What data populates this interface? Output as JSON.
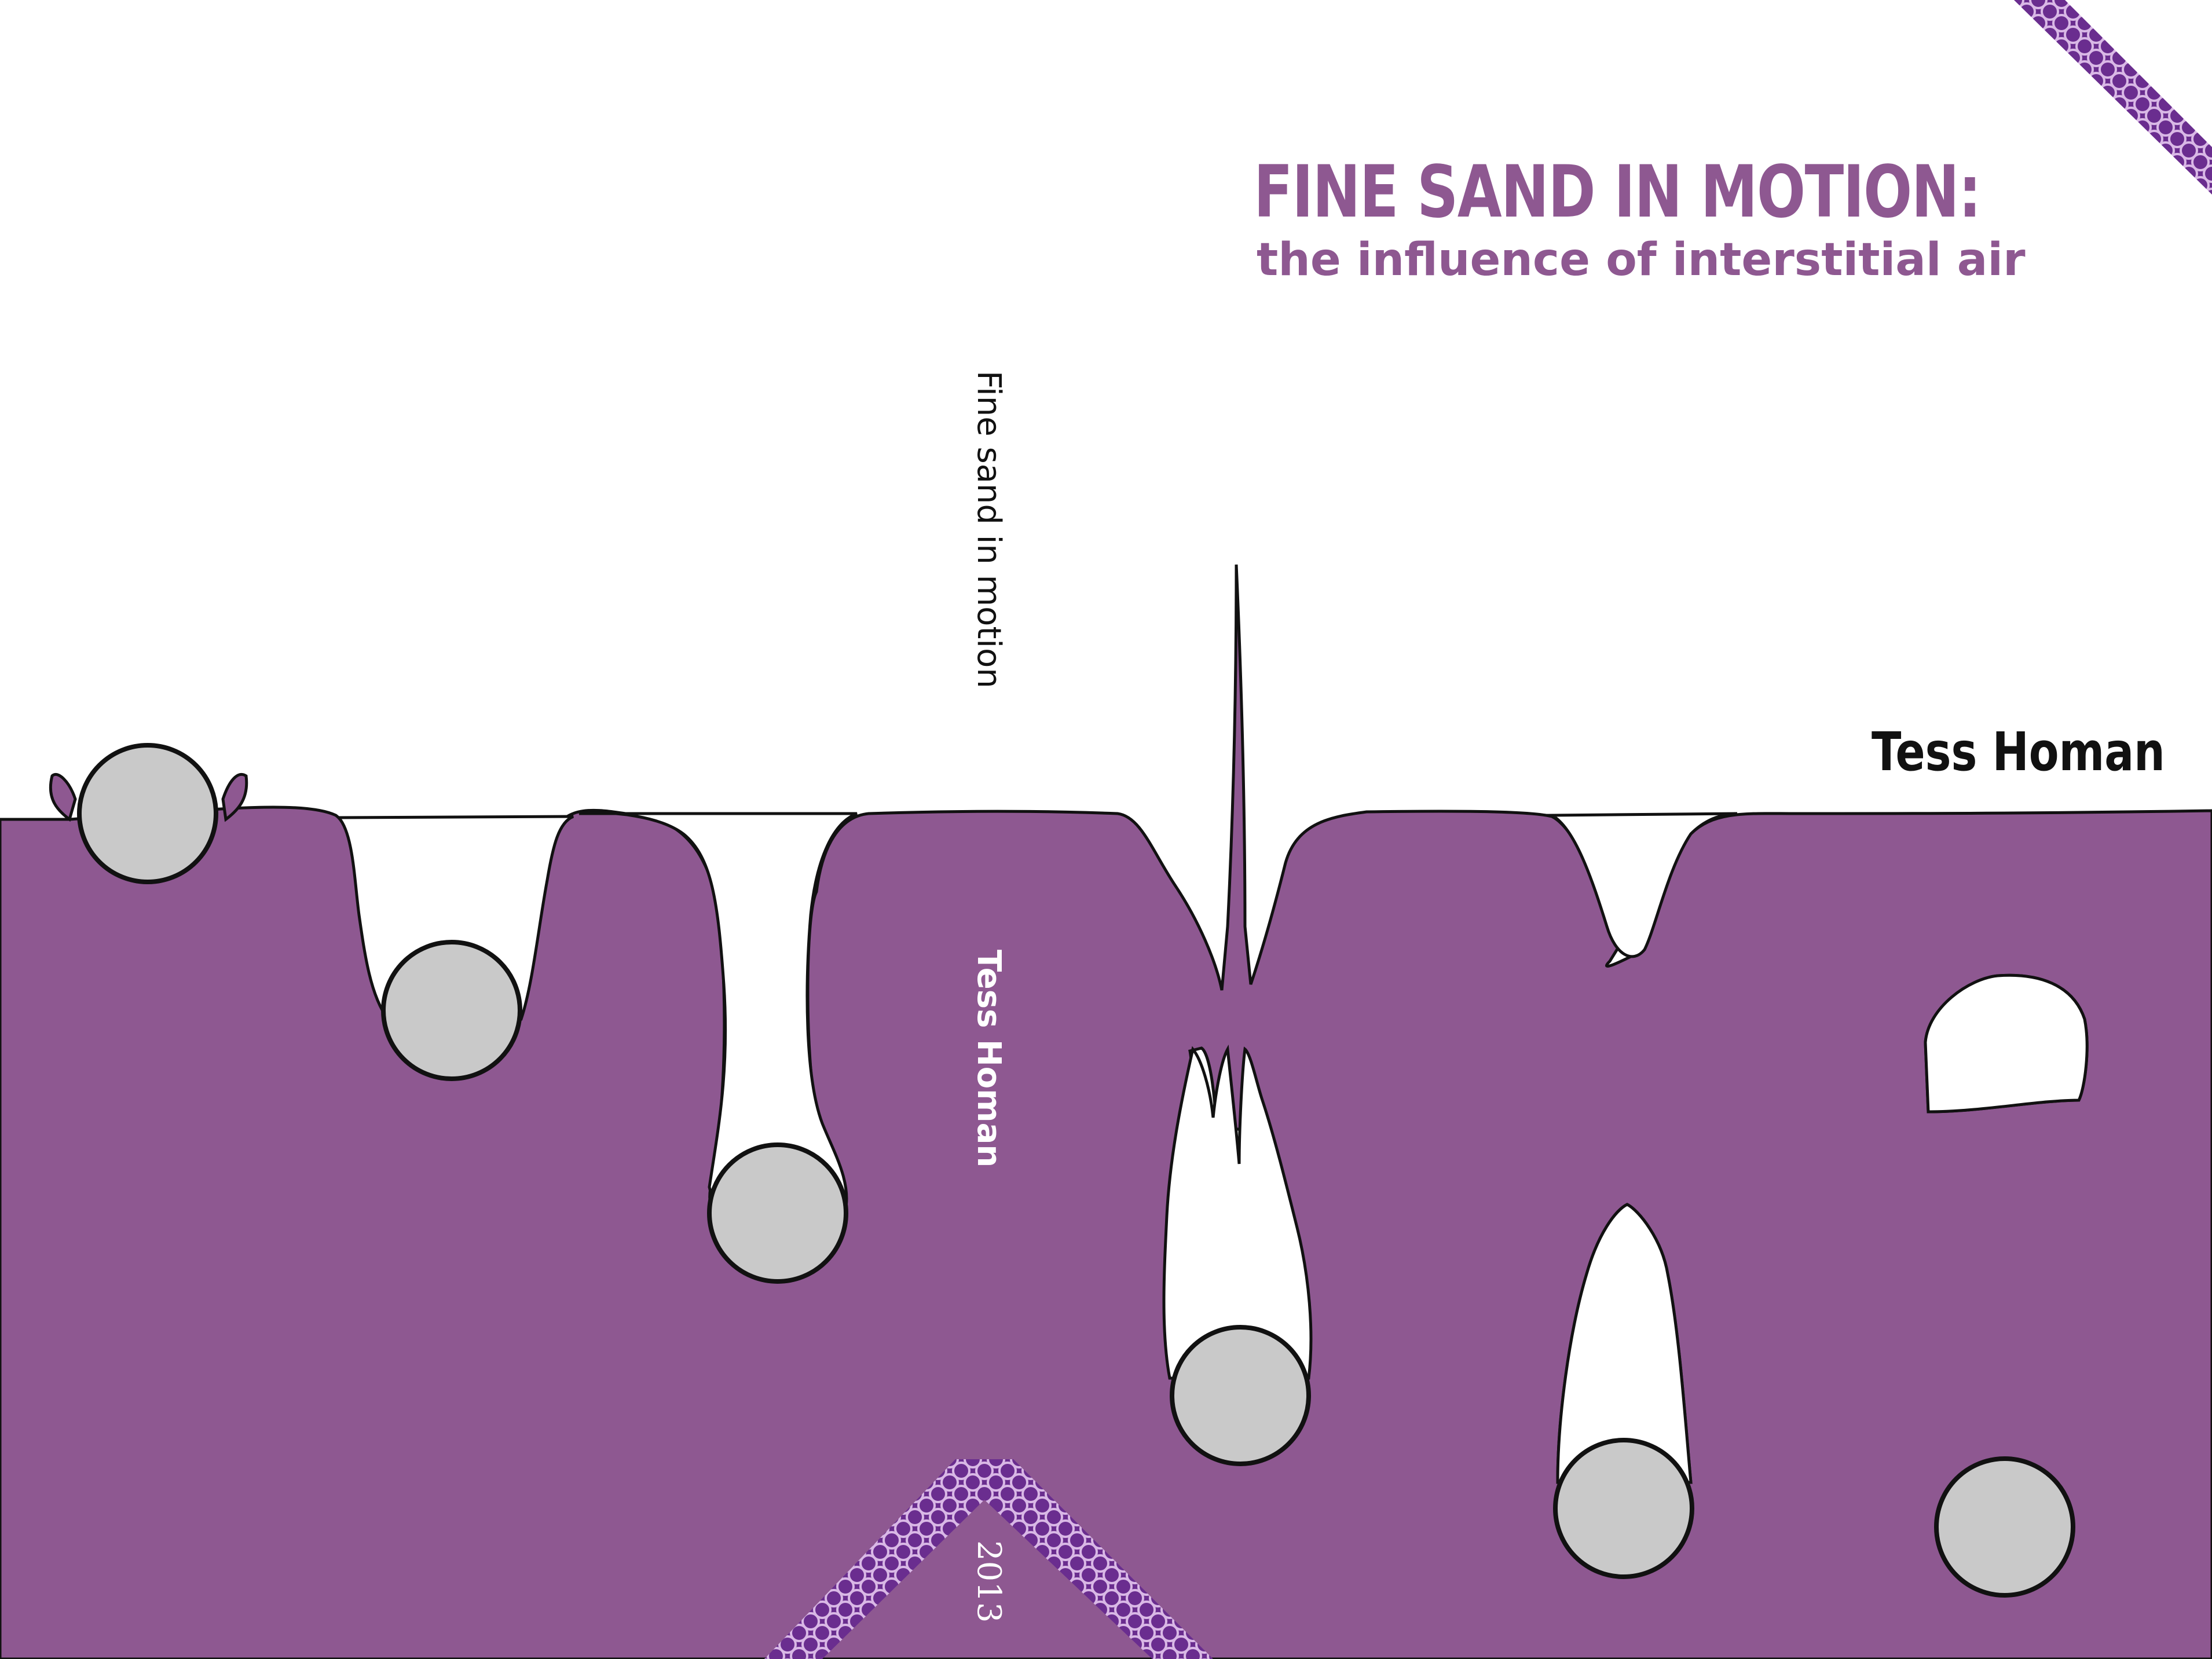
{
  "cover": {
    "title": "FINE SAND IN MOTION:",
    "subtitle": "the influence of interstitial air",
    "author": "Tess Homan"
  },
  "spine": {
    "title": "Fine sand in motion",
    "author": "Tess Homan",
    "year": "2013"
  },
  "colors": {
    "sand": "#8e5891",
    "sphere": "#c9c9c9",
    "pattern_dark": "#6a2d8f",
    "pattern_light": "#d9b8e6"
  }
}
